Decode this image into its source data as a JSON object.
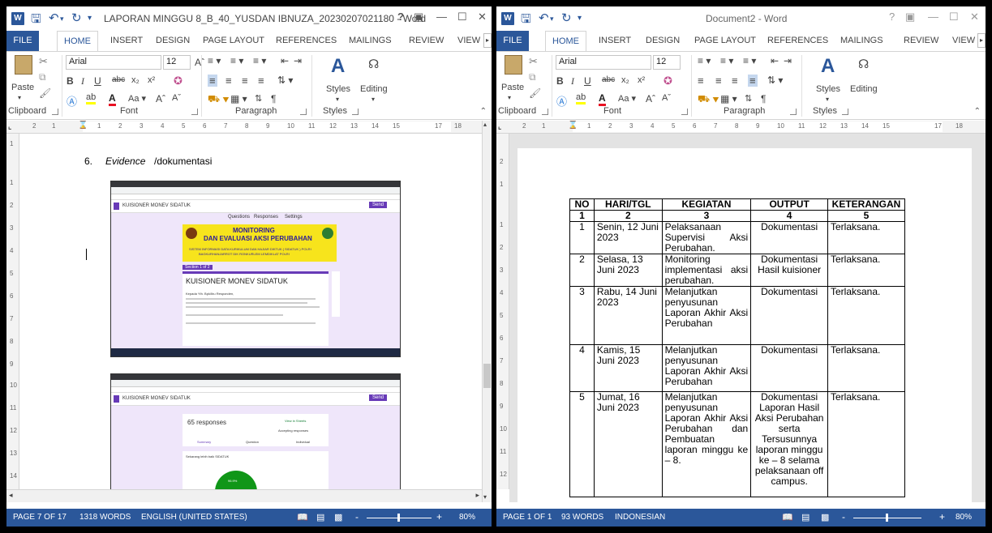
{
  "left_window": {
    "title": "LAPORAN MINGGU 8_B_40_YUSDAN IBNUZA_20230207021180 - Word",
    "help": "?",
    "tabs": [
      "FILE",
      "HOME",
      "INSERT",
      "DESIGN",
      "PAGE LAYOUT",
      "REFERENCES",
      "MAILINGS",
      "REVIEW",
      "VIEW"
    ],
    "font_name": "Arial",
    "font_size": "12",
    "groups": {
      "clipboard": "Clipboard",
      "font": "Font",
      "paragraph": "Paragraph",
      "styles": "Styles"
    },
    "paste": "Paste",
    "styles_label": "Styles",
    "editing_label": "Editing",
    "ruler_numbers": [
      "2",
      "1",
      "1",
      "2",
      "3",
      "4",
      "5",
      "6",
      "7",
      "8",
      "9",
      "10",
      "11",
      "12",
      "13",
      "14",
      "15",
      "17",
      "18"
    ],
    "vruler_numbers": [
      "1",
      "1",
      "2",
      "3",
      "4",
      "5",
      "6",
      "7",
      "8",
      "9",
      "10",
      "11",
      "12",
      "13",
      "14",
      "15"
    ],
    "doc": {
      "item_number": "6.",
      "item_italic": "Evidence",
      "item_rest": "/dokumentasi",
      "ss1": {
        "form_title": "KUISIONER MONEV SIDATUK",
        "tabs": [
          "Questions",
          "Responses",
          "Settings"
        ],
        "banner_line1": "MONITORING",
        "banner_line2": "DAN EVALUASI AKSI PERUBAHAN",
        "banner_sub": "SISTEM INFORMASI DATA KURIKULUM DAN HAJIAR DIKTUK ( SIDATUK ) POLRI",
        "banner_sub2": "BAGKURHANJARROT DIK RONKURLEM LEMDIKLAT POLRI",
        "section": "Section 1 of 2",
        "heading": "KUISIONER MONEV SIDATUK",
        "body": "Kepada Yth. Bpk/Ibu Responden,",
        "send": "Send"
      },
      "ss2": {
        "form_title": "KUISIONER MONEV SIDATUK",
        "responses": "65 responses",
        "view_sheets": "View in Sheets",
        "accepting": "Accepting responses",
        "tabs": [
          "Summary",
          "Question",
          "Individual"
        ],
        "q_text": "Sekarang lebih baik SIDATUK",
        "send": "Send",
        "pie_label": "96.9%"
      }
    },
    "status": {
      "page": "PAGE 7 OF 17",
      "words": "1318 WORDS",
      "lang": "ENGLISH (UNITED STATES)",
      "zoom": "80%",
      "minus": "-",
      "plus": "+"
    }
  },
  "right_window": {
    "title": "Document2 - Word",
    "help": "?",
    "tabs": [
      "FILE",
      "HOME",
      "INSERT",
      "DESIGN",
      "PAGE LAYOUT",
      "REFERENCES",
      "MAILINGS",
      "REVIEW",
      "VIEW"
    ],
    "font_name": "Arial",
    "font_size": "12",
    "groups": {
      "clipboard": "Clipboard",
      "font": "Font",
      "paragraph": "Paragraph",
      "styles": "Styles"
    },
    "paste": "Paste",
    "styles_label": "Styles",
    "editing_label": "Editing",
    "ruler_numbers": [
      "2",
      "1",
      "1",
      "2",
      "3",
      "4",
      "5",
      "6",
      "7",
      "8",
      "9",
      "10",
      "11",
      "12",
      "13",
      "14",
      "15",
      "17",
      "18"
    ],
    "vruler_numbers": [
      "2",
      "1",
      "1",
      "2",
      "3",
      "4",
      "5",
      "6",
      "7",
      "8",
      "9",
      "10",
      "11",
      "12",
      "13"
    ],
    "table": {
      "headers": [
        "NO",
        "HARI/TGL",
        "KEGIATAN",
        "OUTPUT",
        "KETERANGAN"
      ],
      "index_row": [
        "1",
        "2",
        "3",
        "4",
        "5"
      ],
      "rows": [
        {
          "no": "1",
          "hari": "Senin, 12 Juni 2023",
          "kegiatan": "Pelaksanaan Supervisi Aksi Perubahan.",
          "output": "Dokumentasi",
          "ket": "Terlaksana."
        },
        {
          "no": "2",
          "hari": "Selasa, 13 Juni 2023",
          "kegiatan": "Monitoring implementasi aksi perubahan.",
          "output": "Dokumentasi Hasil kuisioner",
          "ket": "Terlaksana."
        },
        {
          "no": "3",
          "hari": "Rabu, 14 Juni 2023",
          "kegiatan": "Melanjutkan penyusunan Laporan Akhir Aksi Perubahan",
          "output": "Dokumentasi",
          "ket": "Terlaksana."
        },
        {
          "no": "4",
          "hari": "Kamis, 15 Juni 2023",
          "kegiatan": "Melanjutkan penyusunan Laporan Akhir Aksi Perubahan",
          "output": "Dokumentasi",
          "ket": "Terlaksana."
        },
        {
          "no": "5",
          "hari": "Jumat, 16 Juni 2023",
          "kegiatan": "Melanjutkan penyusunan Laporan Akhir Aksi Perubahan dan Pembuatan laporan minggu ke – 8.",
          "output": "Dokumentasi Laporan Hasil Aksi Perubahan serta Tersusunnya laporan minggu ke – 8 selama pelaksanaan off campus.",
          "ket": "Terlaksana."
        }
      ]
    },
    "status": {
      "page": "PAGE 1 OF 1",
      "words": "93 WORDS",
      "lang": "INDONESIAN",
      "zoom": "80%",
      "minus": "-",
      "plus": "+"
    }
  },
  "colors": {
    "word_blue": "#2b579a",
    "ribbon_border": "#d4d4d4",
    "doc_bg": "#e3e3e3"
  }
}
